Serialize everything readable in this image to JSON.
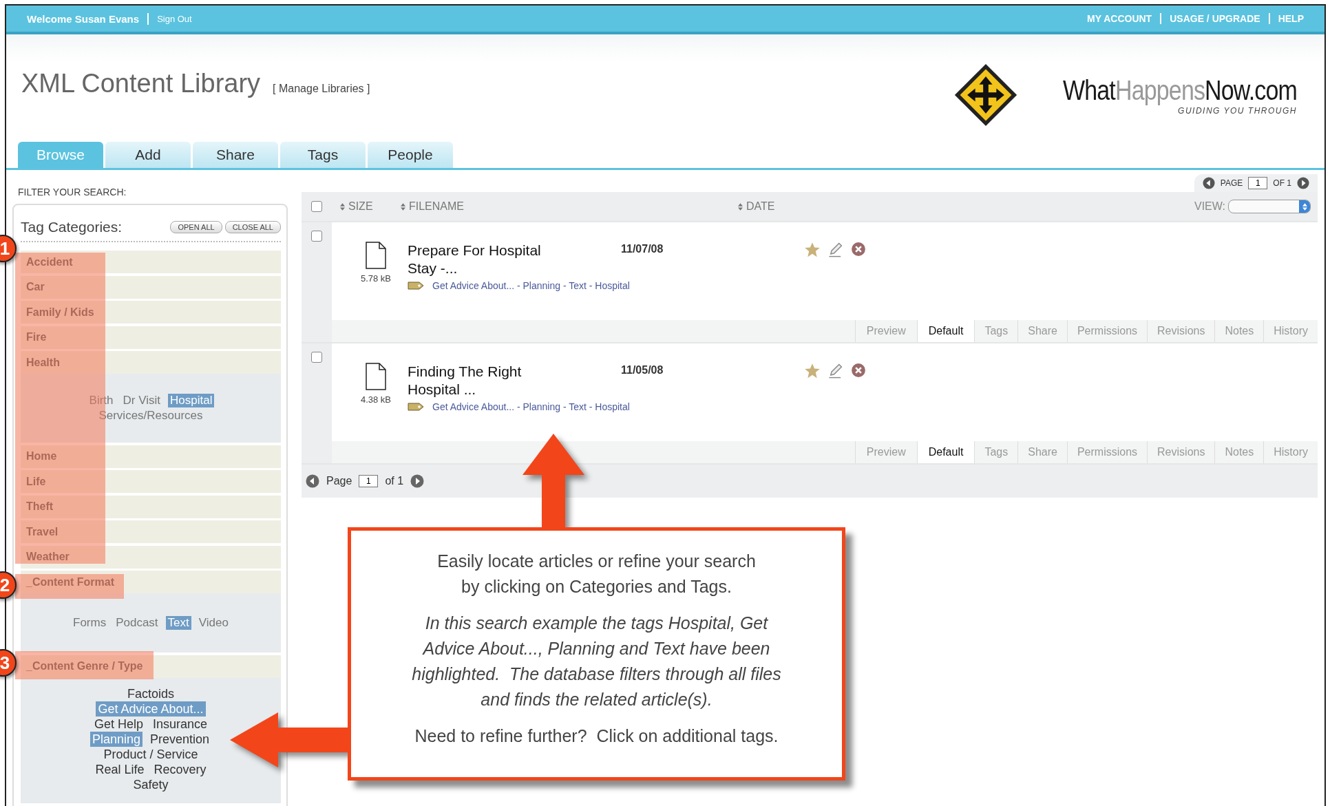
{
  "top_bar": {
    "welcome": "Welcome Susan Evans",
    "sign_out": "Sign Out",
    "links": [
      "MY ACCOUNT",
      "USAGE / UPGRADE",
      "HELP"
    ]
  },
  "header": {
    "title": "XML Content Library",
    "manage_link": "[ Manage Libraries ]",
    "logo": {
      "parts": [
        "What",
        "Happens",
        "Now.com"
      ],
      "tagline": "GUIDING YOU THROUGH"
    }
  },
  "tabs": [
    {
      "label": "Browse",
      "selected": true
    },
    {
      "label": "Add",
      "selected": false
    },
    {
      "label": "Share",
      "selected": false
    },
    {
      "label": "Tags",
      "selected": false
    },
    {
      "label": "People",
      "selected": false
    }
  ],
  "filter_label": "FILTER YOUR SEARCH:",
  "tag_panel": {
    "title": "Tag Categories:",
    "buttons": [
      "OPEN ALL",
      "CLOSE ALL"
    ],
    "categories": [
      {
        "label": "Accident"
      },
      {
        "label": "Car"
      },
      {
        "label": "Family / Kids"
      },
      {
        "label": "Fire"
      },
      {
        "label": "Health",
        "tags": [
          {
            "label": "Birth",
            "selected": false
          },
          {
            "label": "Dr Visit",
            "selected": false
          },
          {
            "label": "Hospital",
            "selected": true
          },
          {
            "label": "Services/Resources",
            "selected": false
          }
        ]
      },
      {
        "label": "Home"
      },
      {
        "label": "Life"
      },
      {
        "label": "Theft"
      },
      {
        "label": "Travel"
      },
      {
        "label": "Weather"
      },
      {
        "label": "_Content Format",
        "tags": [
          {
            "label": "Forms",
            "selected": false
          },
          {
            "label": "Podcast",
            "selected": false
          },
          {
            "label": "Text",
            "selected": true
          },
          {
            "label": "Video",
            "selected": false
          }
        ]
      },
      {
        "label": "_Content Genre / Type",
        "tags": [
          {
            "label": "Factoids",
            "selected": false
          },
          {
            "label": "Get Advice About...",
            "selected": true
          },
          {
            "label": "Get Help",
            "selected": false
          },
          {
            "label": "Insurance",
            "selected": false
          },
          {
            "label": "Planning",
            "selected": true
          },
          {
            "label": "Prevention",
            "selected": false
          },
          {
            "label": "Product / Service",
            "selected": false
          },
          {
            "label": "Real Life",
            "selected": false
          },
          {
            "label": "Recovery",
            "selected": false
          },
          {
            "label": "Safety",
            "selected": false
          }
        ]
      }
    ]
  },
  "pager_top": {
    "label": "PAGE",
    "value": "1",
    "of": "OF 1"
  },
  "select_all_checked": false,
  "columns": [
    "SIZE",
    "FILENAME",
    "DATE"
  ],
  "view": {
    "label": "VIEW:"
  },
  "files": [
    {
      "title": "Prepare For Hospital Stay -...",
      "size": "5.78 kB",
      "date": "11/07/08",
      "tags": "Get Advice About... - Planning - Text - Hospital",
      "checked": false,
      "tabs": [
        {
          "label": "Preview",
          "selected": false
        },
        {
          "label": "Default",
          "selected": true
        },
        {
          "label": "Tags",
          "selected": false
        },
        {
          "label": "Share",
          "selected": false
        },
        {
          "label": "Permissions",
          "selected": false
        },
        {
          "label": "Revisions",
          "selected": false
        },
        {
          "label": "Notes",
          "selected": false
        },
        {
          "label": "History",
          "selected": false
        }
      ]
    },
    {
      "title": "Finding The Right Hospital ...",
      "size": "4.38 kB",
      "date": "11/05/08",
      "tags": "Get Advice About... - Planning - Text - Hospital",
      "checked": false,
      "tabs": [
        {
          "label": "Preview",
          "selected": false
        },
        {
          "label": "Default",
          "selected": true
        },
        {
          "label": "Tags",
          "selected": false
        },
        {
          "label": "Share",
          "selected": false
        },
        {
          "label": "Permissions",
          "selected": false
        },
        {
          "label": "Revisions",
          "selected": false
        },
        {
          "label": "Notes",
          "selected": false
        },
        {
          "label": "History",
          "selected": false
        }
      ]
    }
  ],
  "pager_bottom": {
    "label": "Page",
    "value": "1",
    "of": "of 1"
  },
  "callout": {
    "paragraphs": [
      {
        "kind": "plain",
        "text": "Easily locate articles or refine your search by clicking on Categories and Tags."
      },
      {
        "kind": "italic",
        "text": "In this search example the tags Hospital, Get Advice About..., Planning and Text have been highlighted.  The database filters through all files and finds the related article(s)."
      },
      {
        "kind": "plain",
        "text": "Need to refine further?  Click on additional tags."
      }
    ]
  },
  "markers": [
    "1",
    "2",
    "3"
  ]
}
